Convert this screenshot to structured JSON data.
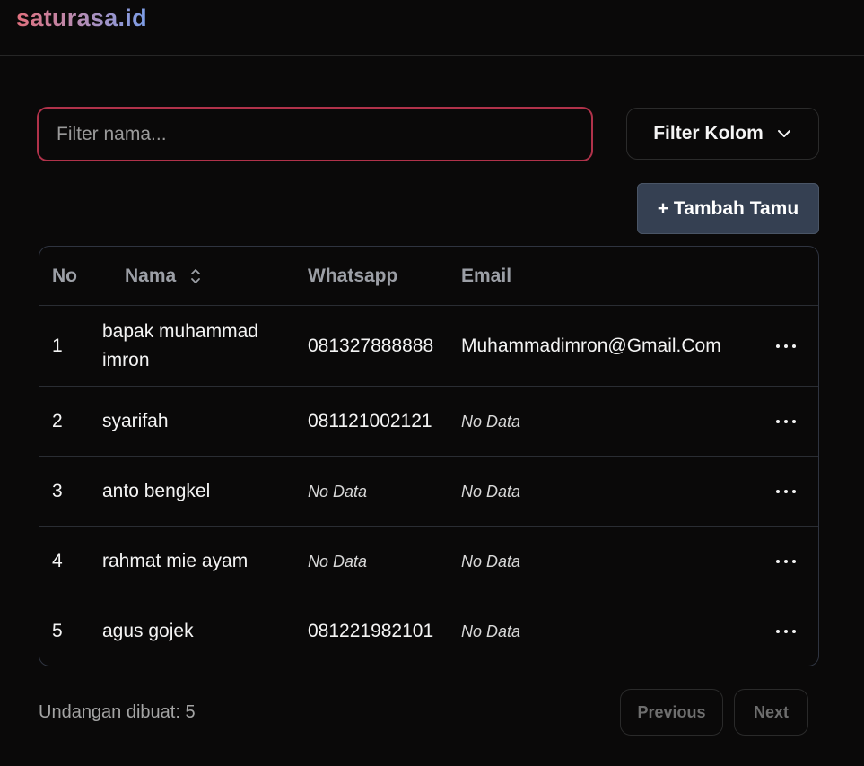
{
  "header": {
    "brand": "saturasa.id"
  },
  "filter": {
    "placeholder": "Filter nama...",
    "value": "",
    "column_button": "Filter Kolom"
  },
  "add_button": {
    "label": "+ Tambah Tamu"
  },
  "table": {
    "headers": {
      "no": "No",
      "nama": "Nama",
      "whatsapp": "Whatsapp",
      "email": "Email"
    },
    "rows": [
      {
        "no": "1",
        "nama": "bapak muhammad imron",
        "whatsapp": "081327888888",
        "email": "Muhammadimron@Gmail.Com"
      },
      {
        "no": "2",
        "nama": "syarifah",
        "whatsapp": "081121002121",
        "email": "No Data"
      },
      {
        "no": "3",
        "nama": "anto bengkel",
        "whatsapp": "No Data",
        "email": "No Data"
      },
      {
        "no": "4",
        "nama": "rahmat mie ayam",
        "whatsapp": "No Data",
        "email": "No Data"
      },
      {
        "no": "5",
        "nama": "agus gojek",
        "whatsapp": "081221982101",
        "email": "No Data"
      }
    ]
  },
  "footer": {
    "count_text": "Undangan dibuat: 5",
    "previous": "Previous",
    "next": "Next"
  }
}
